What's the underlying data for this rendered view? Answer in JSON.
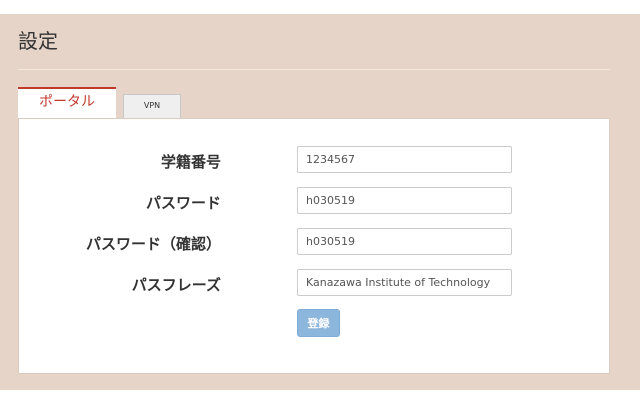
{
  "page": {
    "title": "設定"
  },
  "tabs": [
    {
      "label": "ポータル",
      "active": true
    },
    {
      "label": "VPN",
      "active": false
    }
  ],
  "form": {
    "fields": [
      {
        "label": "学籍番号",
        "value": "1234567"
      },
      {
        "label": "パスワード",
        "value": "h030519"
      },
      {
        "label": "パスワード（確認）",
        "value": "h030519"
      },
      {
        "label": "パスフレーズ",
        "value": "Kanazawa Institute of Technology"
      }
    ],
    "submit_label": "登録"
  },
  "colors": {
    "panel_background": "#e6d4c8",
    "active_tab_accent": "#c0392b",
    "button_background": "#8cb6dc"
  }
}
